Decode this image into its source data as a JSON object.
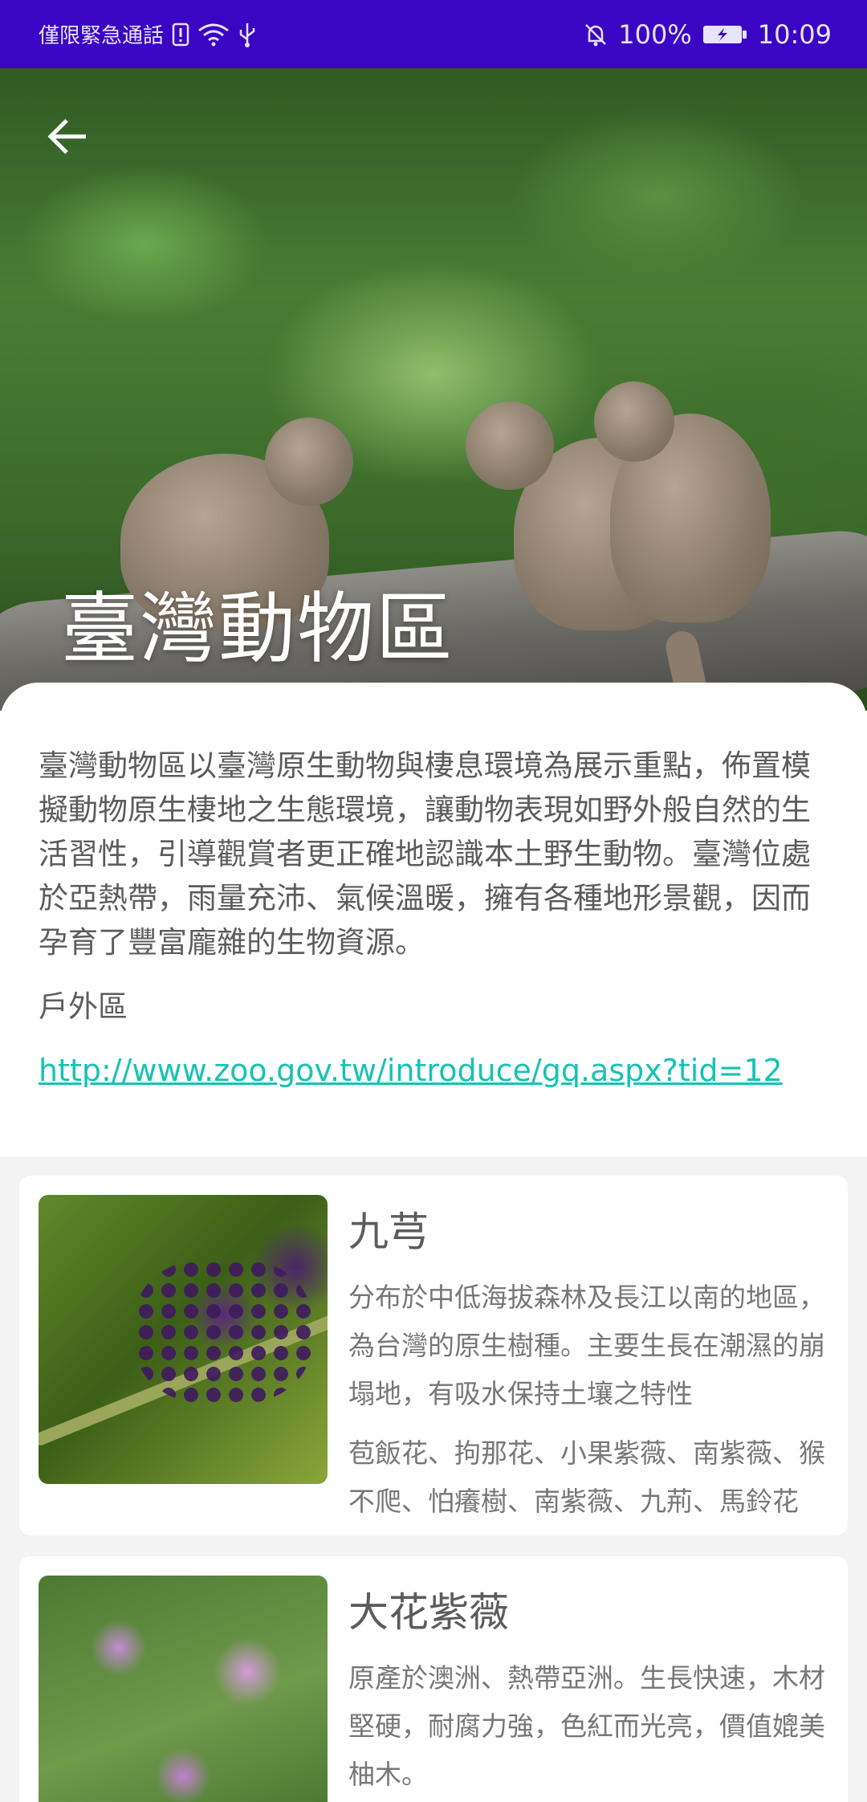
{
  "status_bar": {
    "carrier": "僅限緊急通話",
    "battery": "100%",
    "time": "10:09"
  },
  "header": {
    "back_icon": "arrow-left-icon",
    "title": "臺灣動物區"
  },
  "info": {
    "description": "臺灣動物區以臺灣原生動物與棲息環境為展示重點，佈置模擬動物原生棲地之生態環境，讓動物表現如野外般自然的生活習性，引導觀賞者更正確地認識本土野生動物。臺灣位處於亞熱帶，雨量充沛、氣候溫暖，擁有各種地形景觀，因而孕育了豐富龐雜的生物資源。",
    "area_type": "戶外區",
    "link": "http://www.zoo.gov.tw/introduce/gq.aspx?tid=12"
  },
  "plants": [
    {
      "name": "九芎",
      "description": "分布於中低海拔森林及長江以南的地區，為台灣的原生樹種。主要生長在潮濕的崩塌地，有吸水保持土壤之特性",
      "aliases": "苞飯花、拘那花、小果紫薇、南紫薇、猴不爬、怕癢樹、南紫薇、九荊、馬鈴花"
    },
    {
      "name": "大花紫薇",
      "description": "原產於澳洲、熱帶亞洲。生長快速，木材堅硬，耐腐力強，色紅而光亮，價值媲美柚木。",
      "aliases": ""
    }
  ],
  "colors": {
    "status_bar": "#3a06c4",
    "link": "#16c3b3",
    "text": "#5c5c5c",
    "list_bg": "#f3f3f3"
  }
}
